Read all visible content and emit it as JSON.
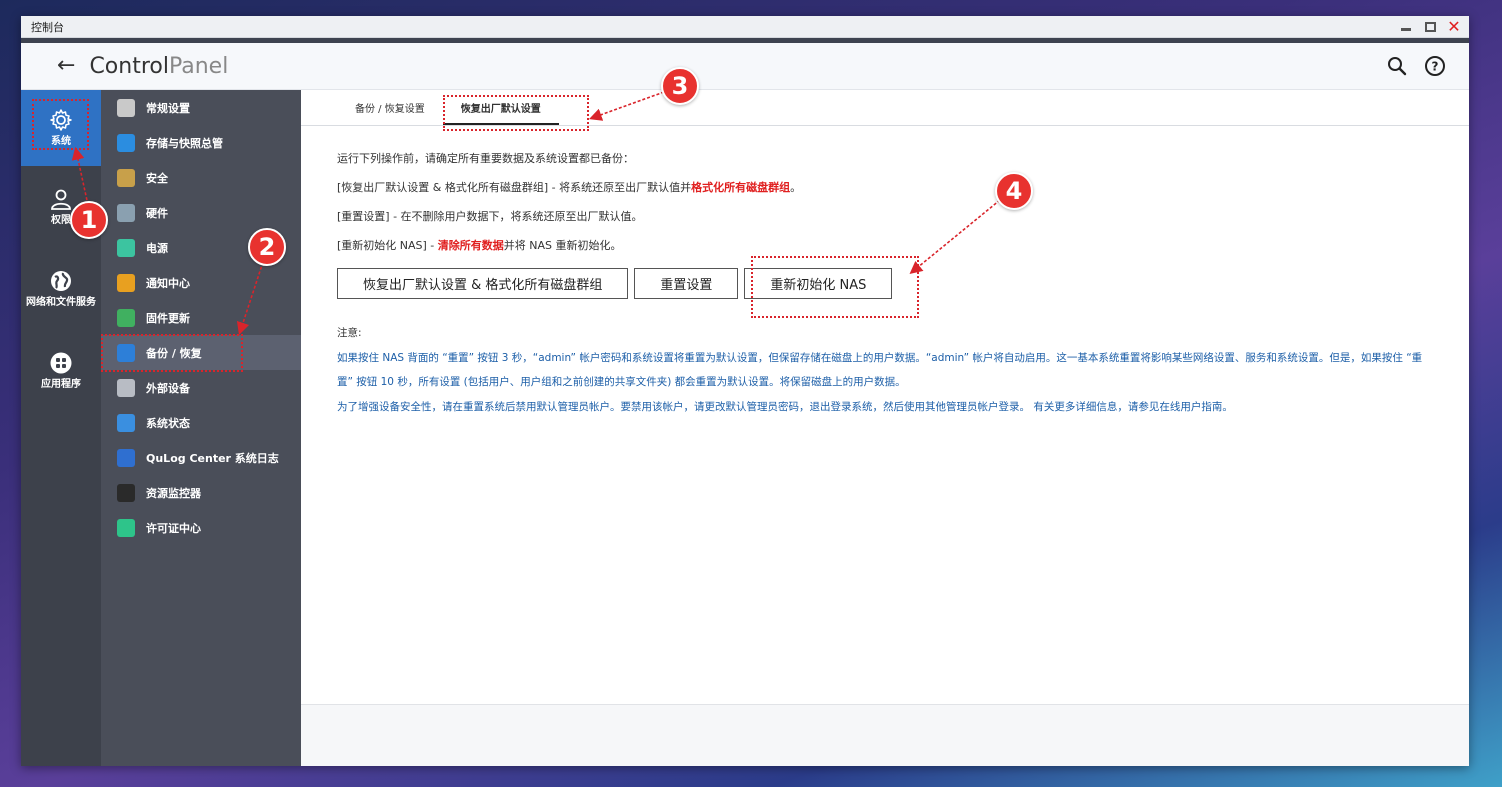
{
  "window": {
    "title": "控制台"
  },
  "header": {
    "brand_bold": "Control",
    "brand_light": "Panel"
  },
  "rail": [
    {
      "label": "系统",
      "icon": "gear-icon"
    },
    {
      "label": "权限",
      "icon": "user-icon"
    },
    {
      "label": "网络和文件服务",
      "icon": "globe-icon"
    },
    {
      "label": "应用程序",
      "icon": "apps-icon"
    }
  ],
  "menu": [
    {
      "label": "常规设置",
      "icon": "general-settings-icon",
      "color": "#c9c9c9"
    },
    {
      "label": "存储与快照总管",
      "icon": "storage-icon",
      "color": "#2b8de0"
    },
    {
      "label": "安全",
      "icon": "lock-icon",
      "color": "#c8a04a"
    },
    {
      "label": "硬件",
      "icon": "hardware-icon",
      "color": "#8aa0b0"
    },
    {
      "label": "电源",
      "icon": "power-icon",
      "color": "#3cc4a0"
    },
    {
      "label": "通知中心",
      "icon": "notification-icon",
      "color": "#e8a020"
    },
    {
      "label": "固件更新",
      "icon": "firmware-icon",
      "color": "#40b060"
    },
    {
      "label": "备份 / 恢复",
      "icon": "backup-icon",
      "color": "#2d7fd8"
    },
    {
      "label": "外部设备",
      "icon": "external-device-icon",
      "color": "#b8bcc4"
    },
    {
      "label": "系统状态",
      "icon": "system-status-icon",
      "color": "#3a8fe0"
    },
    {
      "label": "QuLog Center 系统日志",
      "icon": "qulog-icon",
      "color": "#2f6fd0"
    },
    {
      "label": "资源监控器",
      "icon": "resource-monitor-icon",
      "color": "#2a2a2a"
    },
    {
      "label": "许可证中心",
      "icon": "license-icon",
      "color": "#2ec48a"
    }
  ],
  "tabs": [
    {
      "label": "备份 / 恢复设置"
    },
    {
      "label": "恢复出厂默认设置"
    }
  ],
  "main": {
    "intro": "运行下列操作前，请确定所有重要数据及系统设置都已备份：",
    "line1_a": "[恢复出厂默认设置 & 格式化所有磁盘群组] - 将系统还原至出厂默认值并",
    "line1_b": "格式化所有磁盘群组",
    "line1_c": "。",
    "line2": "[重置设置] - 在不删除用户数据下，将系统还原至出厂默认值。",
    "line3_a": "[重新初始化 NAS] - ",
    "line3_b": "清除所有数据",
    "line3_c": "并将 NAS 重新初始化。",
    "btn_factory": "恢复出厂默认设置 & 格式化所有磁盘群组",
    "btn_reset": "重置设置",
    "btn_reinit": "重新初始化 NAS",
    "note_head": "注意:",
    "note1": "如果按住 NAS 背面的 “重置” 按钮 3 秒，“admin” 帐户密码和系统设置将重置为默认设置，但保留存储在磁盘上的用户数据。“admin” 帐户将自动启用。这一基本系统重置将影响某些网络设置、服务和系统设置。但是，如果按住 “重置” 按钮 10 秒，所有设置 (包括用户、用户组和之前创建的共享文件夹) 都会重置为默认设置。将保留磁盘上的用户数据。",
    "note2": "为了增强设备安全性，请在重置系统后禁用默认管理员帐户。要禁用该帐户，请更改默认管理员密码，退出登录系统，然后使用其他管理员帐户登录。 有关更多详细信息，请参见在线用户指南。"
  },
  "annotations": {
    "b1": "1",
    "b2": "2",
    "b3": "3",
    "b4": "4",
    "color": "#e8322f"
  }
}
